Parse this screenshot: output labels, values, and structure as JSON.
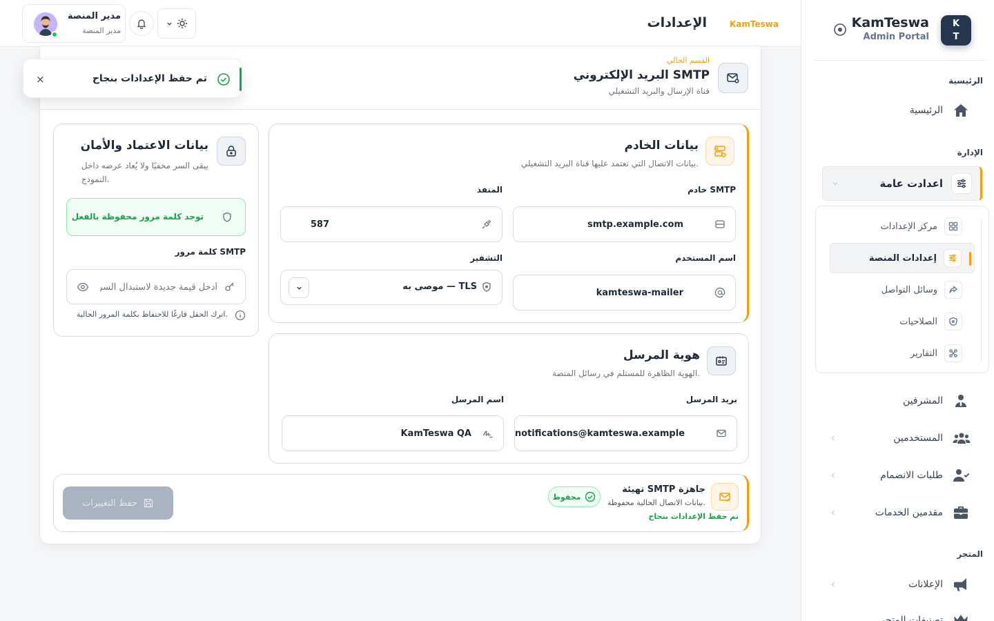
{
  "sidebar": {
    "brand_mark_top": "K",
    "brand_mark_bottom": "T",
    "brand_name": "KamTeswa",
    "brand_sub": "Admin Portal",
    "section_home": "الرئيسية",
    "home": "الرئيسية",
    "section_admin": "الإدارة",
    "general_settings": "اعدادت عامة",
    "sub_items": [
      "مركز الإعدادات",
      "إعدادات المنصة",
      "وسائل التواصل",
      "الصلاحيات",
      "التقارير"
    ],
    "supervisors": "المشرفين",
    "users": "المستخدمين",
    "join_requests": "طلبات الانضمام",
    "providers": "مقدمين الخدمات",
    "section_store": "المتجر",
    "ads": "الإعلانات",
    "last_item": "تصنيفات المتجر"
  },
  "header": {
    "title": "الإعدادات",
    "brand": "KamTeswa",
    "user_name": "مدير المنصة",
    "user_role": "مدير المنصة"
  },
  "section": {
    "kicker": "القسم الحالي",
    "title": "البريد الإلكتروني SMTP",
    "subtitle": "قناة الإرسال والبريد التشغيلي"
  },
  "server_card": {
    "title": "بيانات الخادم",
    "subtitle": "بيانات الاتصال التي تعتمد عليها قناة البريد التشغيلي.",
    "host_label": "خادم SMTP",
    "host_value": "smtp.example.com",
    "port_label": "المنفذ",
    "port_value": "587",
    "username_label": "اسم المستخدم",
    "username_value": "kamteswa-mailer",
    "encryption_label": "التشفير",
    "encryption_value": "TLS — موصى به"
  },
  "sender_card": {
    "title": "هوية المرسل",
    "subtitle": "الهوية الظاهرة للمستلم في رسائل المنصة.",
    "email_label": "بريد المرسل",
    "email_value": "notifications@kamteswa.example",
    "name_label": "اسم المرسل",
    "name_value": "KamTeswa QA"
  },
  "credentials_card": {
    "title": "بيانات الاعتماد والأمان",
    "subtitle_line1": "يبقى السر مخفيًا ولا يُعاد عرضه داخل",
    "subtitle_line2": "النموذج.",
    "saved_notice": "توجد كلمة مرور محفوظة بالفعل",
    "password_label": "كلمة مرور SMTP",
    "password_placeholder": "أدخل قيمة جديدة لاستبدال السر المحفوظ",
    "hint": "اترك الحقل فارغًا للاحتفاظ بكلمة المرور الحالية."
  },
  "footer_bar": {
    "title": "تهيئة SMTP جاهزة",
    "subtitle": "بيانات الاتصال الحالية محفوظة.",
    "success": "تم حفظ الإعدادات بنجاح",
    "badge": "محفوظ",
    "save_button": "حفظ التغييرات"
  },
  "toast": {
    "message": "تم حفظ الإعدادات بنجاح",
    "close": "×"
  },
  "colors": {
    "accent": "#f59e0b",
    "navy": "#26364f",
    "success": "#16a34a"
  }
}
